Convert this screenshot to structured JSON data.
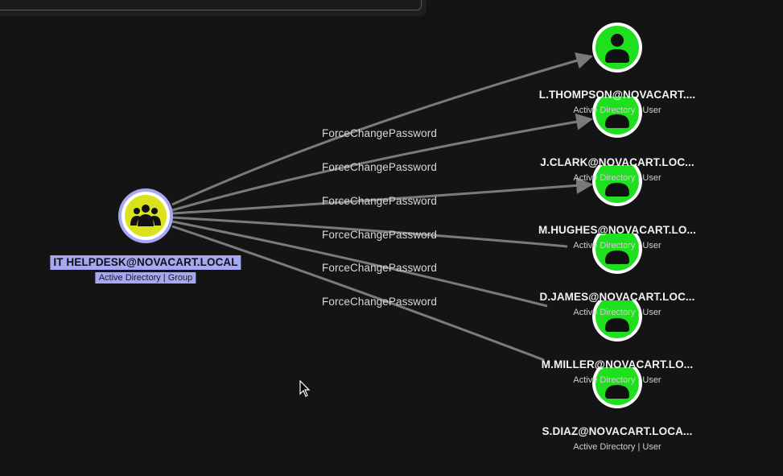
{
  "colors": {
    "background": "#141414",
    "group_fill": "#d9e21b",
    "group_ring": "#a8a8f2",
    "user_fill": "#1fe01f",
    "edge": "#7a7a7a",
    "selected_label_bg": "#a8a8f2"
  },
  "source_node": {
    "name": "IT HELPDESK@NOVACART.LOCAL",
    "type": "Active Directory | Group",
    "icon": "group-icon"
  },
  "target_nodes": [
    {
      "name": "L.THOMPSON@NOVACART....",
      "type": "Active Directory | User",
      "icon": "user-icon"
    },
    {
      "name": "J.CLARK@NOVACART.LOC...",
      "type": "Active Directory | User",
      "icon": "user-icon"
    },
    {
      "name": "M.HUGHES@NOVACART.LO...",
      "type": "Active Directory | User",
      "icon": "user-icon"
    },
    {
      "name": "D.JAMES@NOVACART.LOC...",
      "type": "Active Directory | User",
      "icon": "user-icon"
    },
    {
      "name": "M.MILLER@NOVACART.LO...",
      "type": "Active Directory | User",
      "icon": "user-icon"
    },
    {
      "name": "S.DIAZ@NOVACART.LOCA...",
      "type": "Active Directory | User",
      "icon": "user-icon"
    }
  ],
  "edges": [
    {
      "label": "ForceChangePassword"
    },
    {
      "label": "ForceChangePassword"
    },
    {
      "label": "ForceChangePassword"
    },
    {
      "label": "ForceChangePassword"
    },
    {
      "label": "ForceChangePassword"
    },
    {
      "label": "ForceChangePassword"
    }
  ]
}
